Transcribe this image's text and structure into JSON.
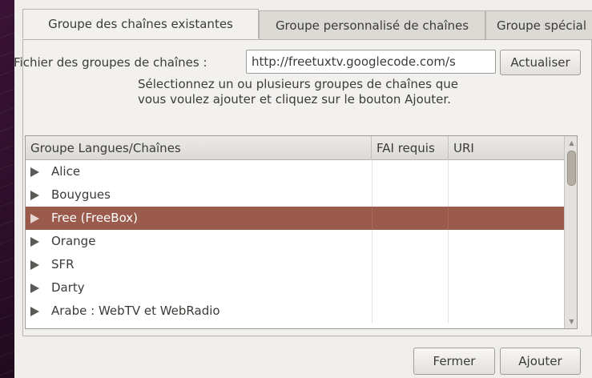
{
  "tabs": [
    {
      "label": "Groupe des chaînes existantes",
      "active": true
    },
    {
      "label": "Groupe personnalisé de chaînes",
      "active": false
    },
    {
      "label": "Groupe spécial",
      "active": false
    }
  ],
  "file": {
    "label": "Fichier des groupes de chaînes :",
    "url_value": "http://freetuxtv.googlecode.com/s",
    "refresh_label": "Actualiser"
  },
  "help_text": "Sélectionnez un ou plusieurs groupes de chaînes que vous voulez ajouter et cliquez sur le bouton Ajouter.",
  "tree": {
    "columns": [
      "Groupe Langues/Chaînes",
      "FAI requis",
      "URI"
    ],
    "rows": [
      {
        "label": "Alice",
        "selected": false
      },
      {
        "label": "Bouygues",
        "selected": false
      },
      {
        "label": "Free (FreeBox)",
        "selected": true
      },
      {
        "label": "Orange",
        "selected": false
      },
      {
        "label": "SFR",
        "selected": false
      },
      {
        "label": "Darty",
        "selected": false
      },
      {
        "label": "Arabe : WebTV et WebRadio",
        "selected": false
      }
    ],
    "selected_color": "#9a5b4d"
  },
  "buttons": {
    "close_label": "Fermer",
    "add_label": "Ajouter"
  }
}
